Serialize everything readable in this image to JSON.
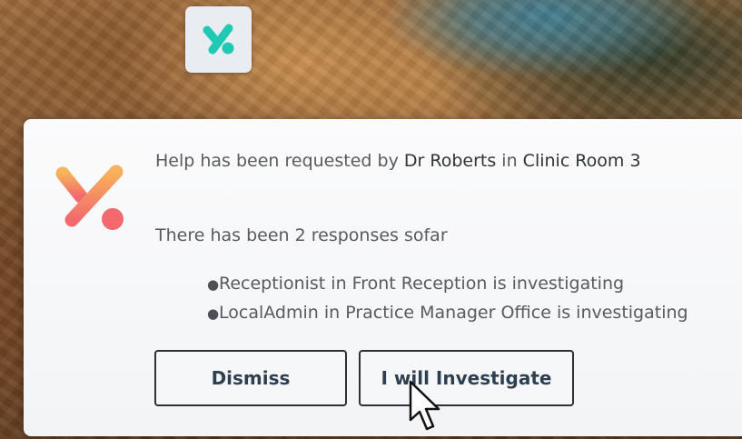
{
  "taskbar": {
    "app_icon": "app-logo-icon",
    "accent": "#1fc9b4"
  },
  "notification": {
    "logo_icon": "app-logo-icon",
    "logo_colors": {
      "top": "#f7b25a",
      "bottom": "#f26a6e"
    },
    "request_prefix": "Help has been requested by",
    "requester": "Dr Roberts",
    "location_connector": "in",
    "location": "Clinic Room 3",
    "responses_summary": "There has been 2 responses sofar",
    "responses": [
      {
        "text": "Receptionist in Front Reception is investigating"
      },
      {
        "text": "LocalAdmin in Practice Manager Office is investigating"
      }
    ],
    "buttons": {
      "dismiss": "Dismiss",
      "investigate": "I will Investigate"
    }
  },
  "cursor": {
    "icon": "mouse-pointer-icon"
  }
}
